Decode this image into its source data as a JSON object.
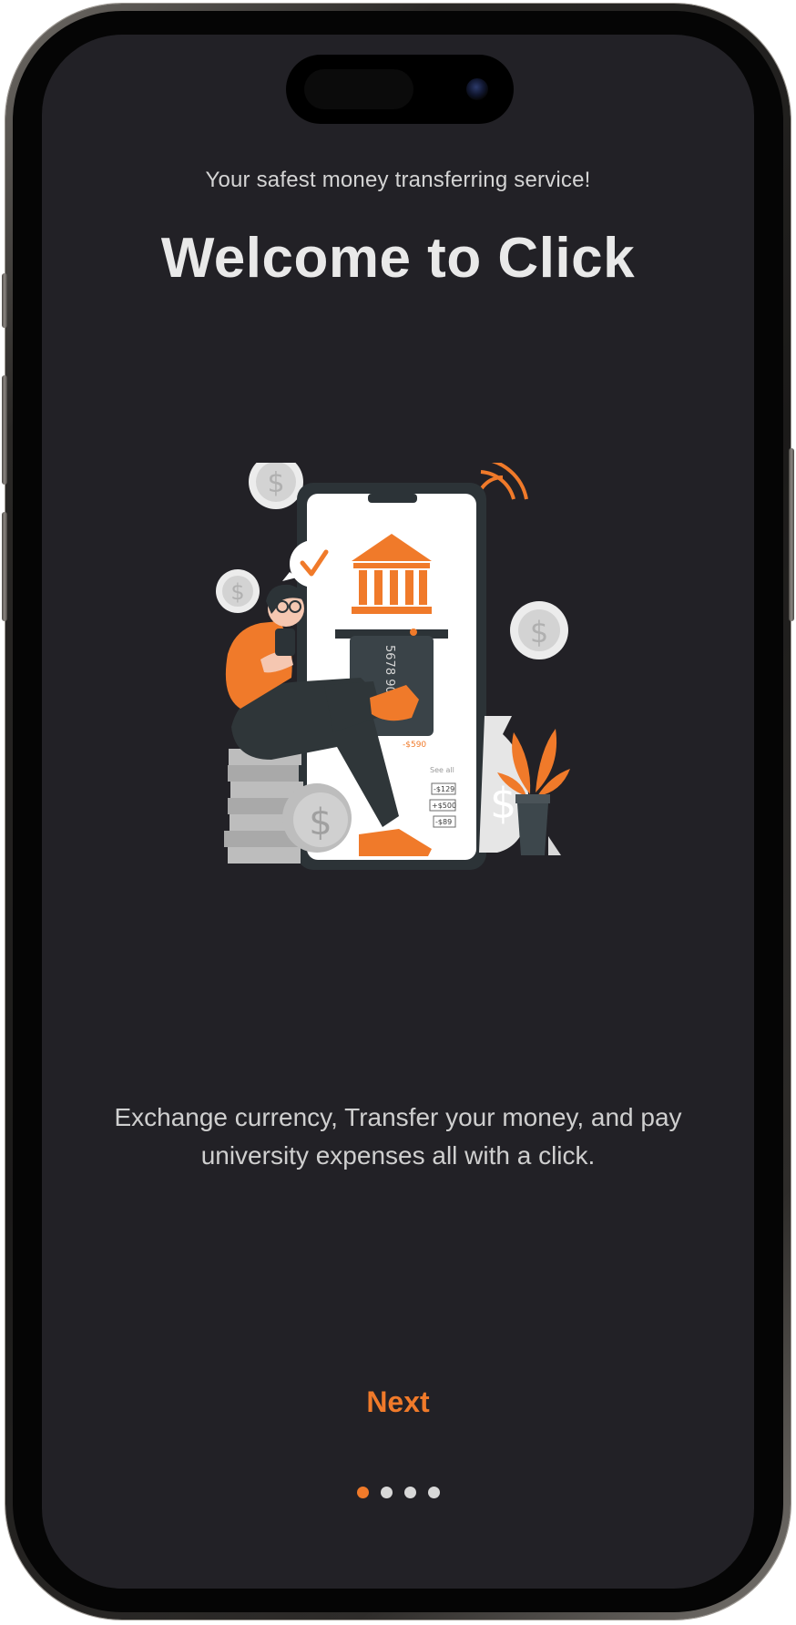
{
  "onboarding": {
    "subtitle": "Your safest money transferring service!",
    "title": "Welcome to Click",
    "description": "Exchange currency, Transfer your money, and pay university expenses all with a click.",
    "next_label": "Next",
    "page_indicator": {
      "total": 4,
      "current": 1
    }
  },
  "illustration": {
    "card_number_fragment": "5678 9012",
    "see_all_label": "See all",
    "balance_value": "-$590",
    "transactions": [
      "-$129",
      "+$500",
      "-$89"
    ]
  },
  "colors": {
    "background": "#222126",
    "accent": "#f07a2a",
    "text_primary": "#e9e9e9",
    "text_secondary": "#cfcfcf",
    "dot_inactive": "#d8d8d8"
  }
}
